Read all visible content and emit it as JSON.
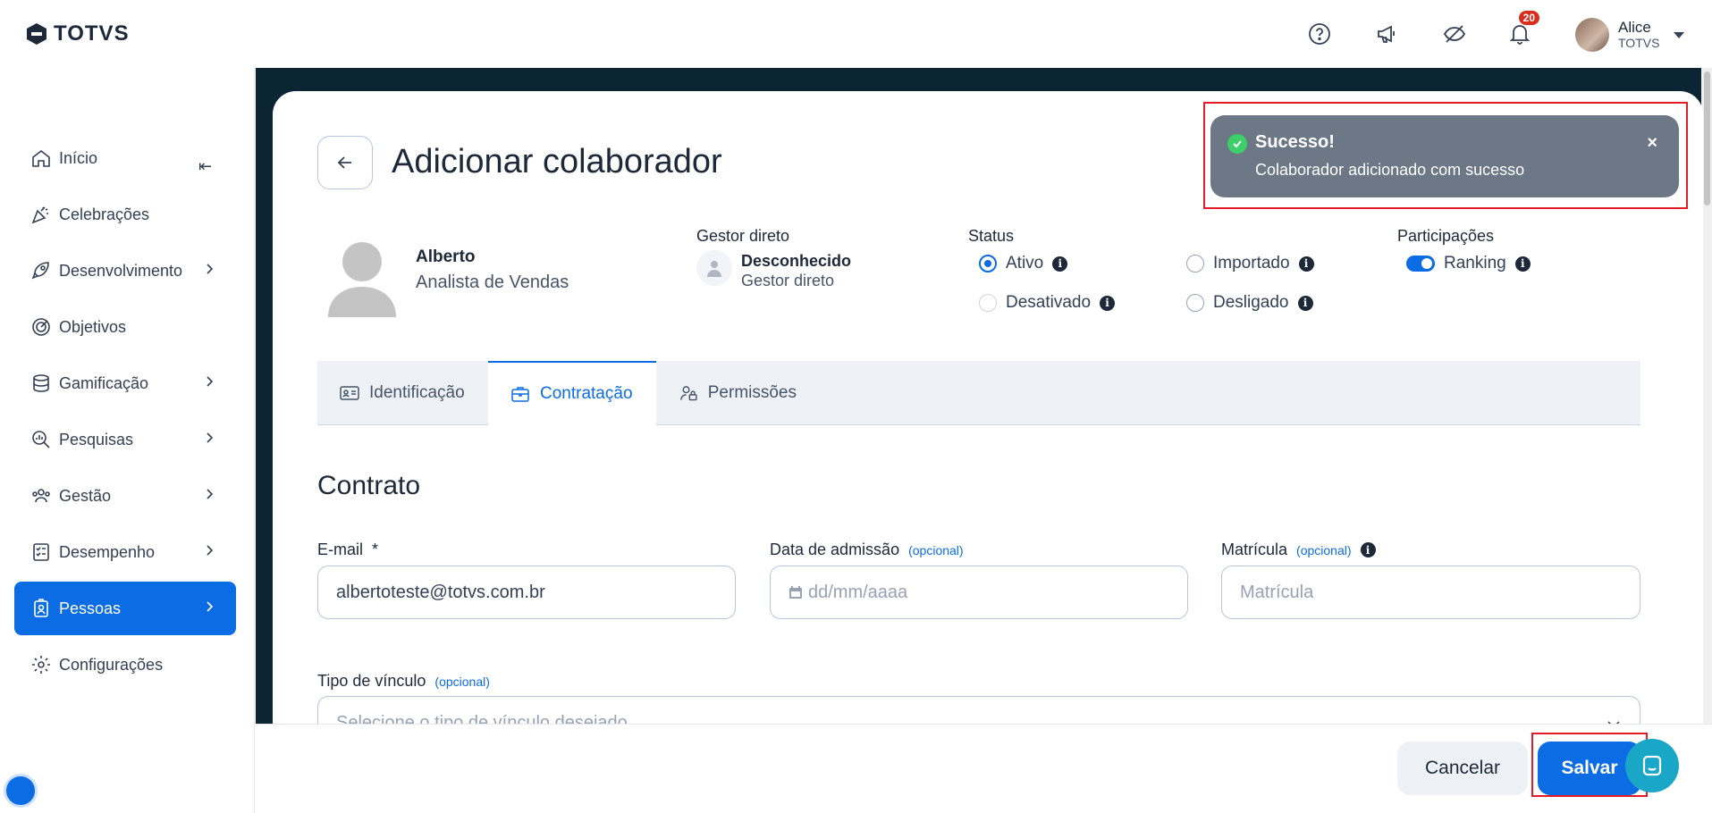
{
  "app": {
    "logo_text": "TOTVS"
  },
  "header": {
    "notifications_count": "20",
    "user_name": "Alice",
    "user_org": "TOTVS"
  },
  "sidebar": {
    "collapse_icon": "collapse-left-icon",
    "items": [
      {
        "label": "Início",
        "icon": "home-icon",
        "has_children": false,
        "active": false
      },
      {
        "label": "Celebrações",
        "icon": "party-icon",
        "has_children": false,
        "active": false
      },
      {
        "label": "Desenvolvimento",
        "icon": "rocket-icon",
        "has_children": true,
        "active": false
      },
      {
        "label": "Objetivos",
        "icon": "target-icon",
        "has_children": false,
        "active": false
      },
      {
        "label": "Gamificação",
        "icon": "coins-icon",
        "has_children": true,
        "active": false
      },
      {
        "label": "Pesquisas",
        "icon": "search-chart-icon",
        "has_children": true,
        "active": false
      },
      {
        "label": "Gestão",
        "icon": "people-icon",
        "has_children": true,
        "active": false
      },
      {
        "label": "Desempenho",
        "icon": "checklist-icon",
        "has_children": true,
        "active": false
      },
      {
        "label": "Pessoas",
        "icon": "badge-icon",
        "has_children": true,
        "active": true
      },
      {
        "label": "Configurações",
        "icon": "gear-icon",
        "has_children": false,
        "active": false
      }
    ]
  },
  "page": {
    "title": "Adicionar colaborador",
    "person": {
      "name": "Alberto",
      "role": "Analista de Vendas"
    },
    "manager": {
      "label": "Gestor direto",
      "name": "Desconhecido",
      "subtitle": "Gestor direto"
    },
    "status": {
      "label": "Status",
      "options": [
        {
          "label": "Ativo",
          "selected": true
        },
        {
          "label": "Importado",
          "selected": false
        },
        {
          "label": "Desativado",
          "selected": false
        },
        {
          "label": "Desligado",
          "selected": false
        }
      ]
    },
    "participations": {
      "label": "Participações",
      "ranking_label": "Ranking",
      "ranking_on": true
    },
    "tabs": [
      {
        "label": "Identificação",
        "active": false
      },
      {
        "label": "Contratação",
        "active": true
      },
      {
        "label": "Permissões",
        "active": false
      }
    ],
    "section_title": "Contrato",
    "fields": {
      "email": {
        "label": "E-mail",
        "required_mark": "*",
        "value": "albertoteste@totvs.com.br"
      },
      "admission": {
        "label": "Data de admissão",
        "optional": "(opcional)",
        "placeholder": "dd/mm/aaaa"
      },
      "registration": {
        "label": "Matrícula",
        "optional": "(opcional)",
        "placeholder": "Matrícula"
      },
      "bond_type": {
        "label": "Tipo de vínculo",
        "optional": "(opcional)",
        "placeholder": "Selecione o tipo de vínculo desejado"
      }
    }
  },
  "footer": {
    "cancel_label": "Cancelar",
    "save_label": "Salvar"
  },
  "toast": {
    "title": "Sucesso!",
    "message": "Colaborador adicionado com sucesso",
    "close": "×"
  },
  "colors": {
    "primary": "#0c6ce4",
    "toast_bg": "#6c7885",
    "highlight": "#e11d2a",
    "content_bg": "#0b2534"
  }
}
